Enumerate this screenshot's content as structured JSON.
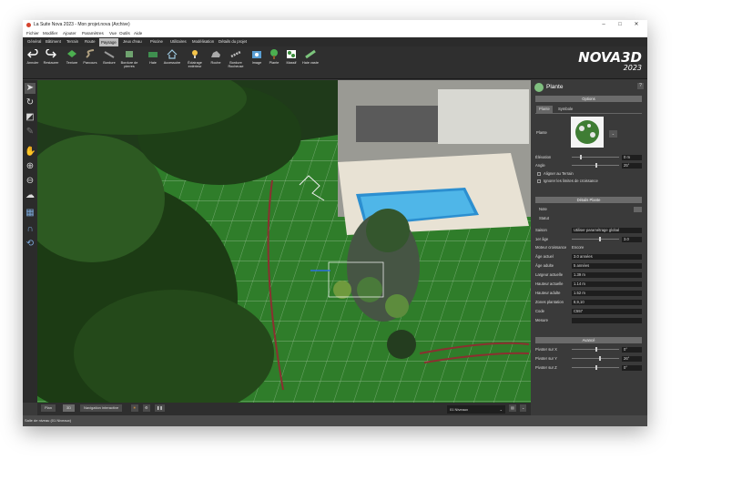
{
  "window": {
    "title": "La Suite Nova 2023 - Mon projet.nova (Archive)"
  },
  "menu": [
    "Fichier",
    "Modifier",
    "Ajouter",
    "Paramètres",
    "Vue",
    "Outils",
    "Aide"
  ],
  "ribbon_tabs": [
    "Général",
    "Bâtiment",
    "Terrain",
    "Route",
    "Paysage",
    "Jeux d'eau",
    "Piscine",
    "Utilitaires",
    "Modélisation",
    "Détails du projet"
  ],
  "active_tab": "Paysage",
  "ribbon_buttons": [
    "Annuler",
    "Restaurer",
    "Texture",
    "Parcours",
    "Bordure",
    "Bordure de pierres",
    "Haie",
    "Accessoire",
    "Éclairage extérieur",
    "Roche",
    "Bordure Rocheuse",
    "Image",
    "Plante",
    "Massif",
    "Haie vaste"
  ],
  "logo": {
    "name": "NOVA3D",
    "year": "2023"
  },
  "view_tabs": [
    "Plan",
    "3D",
    "Navigation interactive"
  ],
  "level_select": "01 Niveaux",
  "status": "Salle de niveau (01 Niveaux)",
  "panel": {
    "title": "Plante",
    "options_header": "Options",
    "tabs": [
      "Plante",
      "Symbole"
    ],
    "plant_label": "Plante",
    "elevation": {
      "label": "Élévation",
      "value": "0 m"
    },
    "angle": {
      "label": "Angle",
      "value": "25°"
    },
    "check1": "Aligner au Terrain",
    "check2": "Ignorer les limites de croissance",
    "details_header": "Détails Plante",
    "note_label": "Note",
    "status_label": "Statut",
    "saison": {
      "label": "Saison",
      "value": "Utiliser paramétrage global"
    },
    "age": {
      "label": "1er âge",
      "value": "3.0"
    },
    "details": [
      {
        "label": "Moteur croissance",
        "value": "Encore"
      },
      {
        "label": "Âge actuel",
        "value": "3.0 années"
      },
      {
        "label": "Âge adulte",
        "value": "5 années"
      },
      {
        "label": "Largeur actuelle",
        "value": "1.39 m"
      },
      {
        "label": "Hauteur actuelle",
        "value": "1.14 m"
      },
      {
        "label": "Hauteur adulte",
        "value": "1.52 m"
      },
      {
        "label": "Zones plantation",
        "value": "8,9,10"
      },
      {
        "label": "Code",
        "value": "C557"
      },
      {
        "label": "Mesure",
        "value": ""
      }
    ],
    "advanced_header": "Avancé",
    "pivots": [
      {
        "label": "Pivoter sur X",
        "value": "0°"
      },
      {
        "label": "Pivoter sur Y",
        "value": "26°"
      },
      {
        "label": "Pivoter sur Z",
        "value": "0°"
      }
    ]
  }
}
